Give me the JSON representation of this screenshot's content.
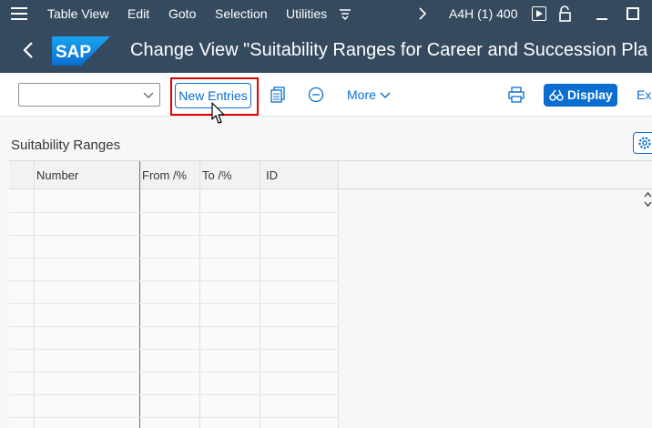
{
  "menubar": {
    "items": [
      "Table View",
      "Edit",
      "Goto",
      "Selection",
      "Utilities"
    ],
    "system_info": "A4H (1) 400"
  },
  "header": {
    "logo_text": "SAP",
    "title": "Change View \"Suitability Ranges for Career and Succession Pla"
  },
  "toolbar": {
    "new_entries_label": "New Entries",
    "more_label": "More",
    "display_label": "Display",
    "exit_label": "Exi"
  },
  "section": {
    "title": "Suitability Ranges"
  },
  "table": {
    "columns": [
      "Number",
      "From /%",
      "To /%",
      "ID"
    ]
  },
  "colors": {
    "shell": "#354a5f",
    "accent": "#0a6ed1",
    "highlight": "#e00000"
  }
}
